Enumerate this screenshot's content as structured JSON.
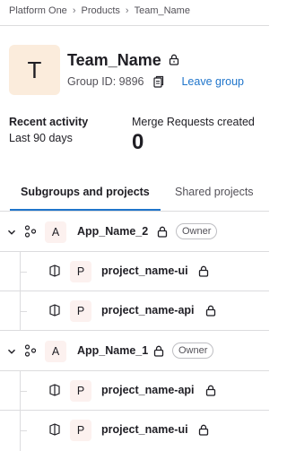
{
  "breadcrumb": {
    "items": [
      "Platform One",
      "Products",
      "Team_Name"
    ]
  },
  "group": {
    "avatar_letter": "T",
    "name": "Team_Name",
    "id_label": "Group ID: 9896",
    "leave_label": "Leave group"
  },
  "stats": {
    "recent_activity_title": "Recent activity",
    "recent_activity_range": "Last 90 days",
    "merge_requests_title": "Merge Requests created",
    "merge_requests_count": "0"
  },
  "tabs": [
    {
      "label": "Subgroups and projects",
      "active": true
    },
    {
      "label": "Shared projects",
      "active": false
    }
  ],
  "tree": {
    "subgroups": [
      {
        "avatar_letter": "A",
        "name": "App_Name_2",
        "role": "Owner",
        "projects": [
          {
            "avatar_letter": "P",
            "name": "project_name-ui"
          },
          {
            "avatar_letter": "P",
            "name": "project_name-api"
          }
        ]
      },
      {
        "avatar_letter": "A",
        "name": "App_Name_1",
        "role": "Owner",
        "projects": [
          {
            "avatar_letter": "P",
            "name": "project_name-api"
          },
          {
            "avatar_letter": "P",
            "name": "project_name-ui"
          }
        ]
      }
    ]
  },
  "colors": {
    "accent": "#1f75cb",
    "group_avatar_bg": "#fbecdc",
    "item_avatar_bg": "#fcf1ef"
  }
}
